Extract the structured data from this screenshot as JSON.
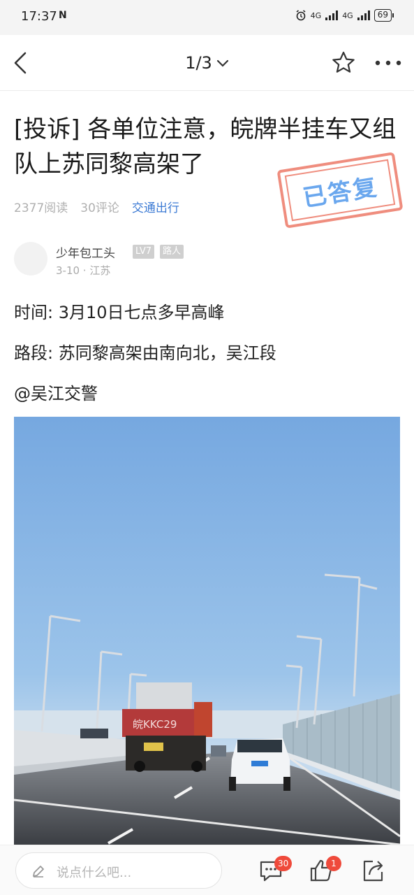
{
  "status_bar": {
    "time": "17:37",
    "nfc_label": "N",
    "signal_label_1": "4G",
    "signal_label_2": "4G",
    "battery": "69"
  },
  "nav": {
    "page_indicator": "1/3"
  },
  "post": {
    "title": "[投诉] 各单位注意，皖牌半挂车又组队上苏同黎高架了",
    "stamp_text": "已答复",
    "read_count": "2377阅读",
    "comment_count": "30评论",
    "topic": "交通出行",
    "author": {
      "name": "少年包工头",
      "level": "LV7",
      "role": "路人",
      "date_location": "3-10 · 江苏"
    },
    "paragraphs": [
      "时间: 3月10日七点多早高峰",
      "路段: 苏同黎高架由南向北，吴江段",
      "@吴江交警"
    ],
    "photo": {
      "plate_text": "皖KKC29"
    }
  },
  "bottom_bar": {
    "input_placeholder": "说点什么吧...",
    "comment_badge": "30",
    "like_badge": "1"
  },
  "colors": {
    "accent_blue": "#3d7bd4",
    "badge_red": "#ef4a3b",
    "stamp_red": "#ef8d7e",
    "stamp_blue": "#6aa7ee"
  }
}
